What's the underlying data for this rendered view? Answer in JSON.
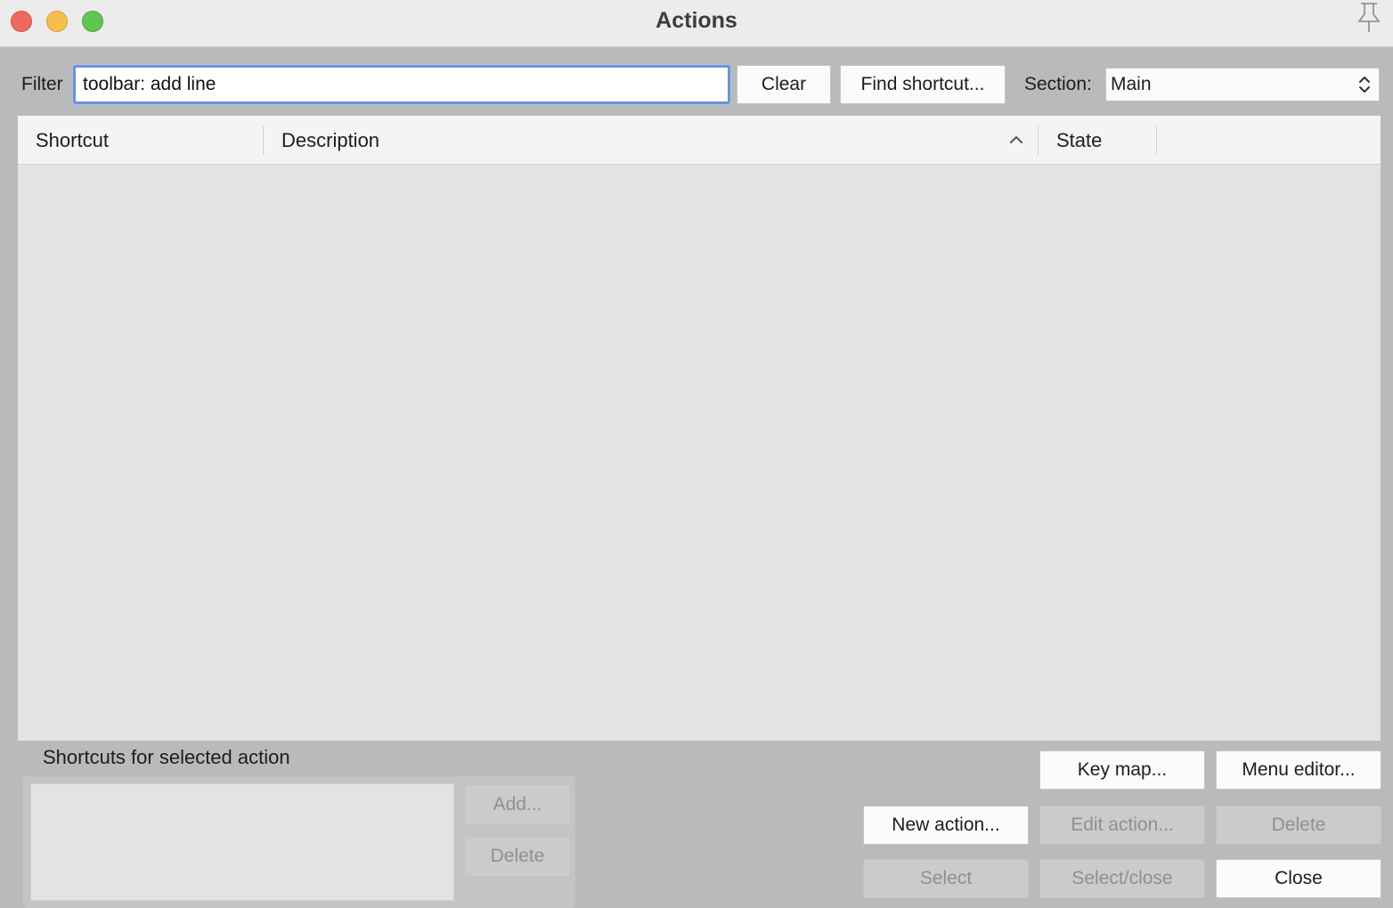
{
  "window": {
    "title": "Actions"
  },
  "filter": {
    "label": "Filter",
    "value": "toolbar: add line"
  },
  "buttons": {
    "clear": "Clear",
    "find_shortcut": "Find shortcut...",
    "add": "Add...",
    "delete_shortcut": "Delete",
    "key_map": "Key map...",
    "menu_editor": "Menu editor...",
    "new_action": "New action...",
    "edit_action": "Edit action...",
    "delete_action": "Delete",
    "select": "Select",
    "select_close": "Select/close",
    "close": "Close"
  },
  "section": {
    "label": "Section:",
    "value": "Main"
  },
  "table": {
    "columns": [
      "Shortcut",
      "Description",
      "State"
    ],
    "sorted_column": "Description",
    "sort_direction": "ascending",
    "rows": []
  },
  "shortcuts_panel": {
    "label": "Shortcuts for selected action",
    "items": []
  }
}
